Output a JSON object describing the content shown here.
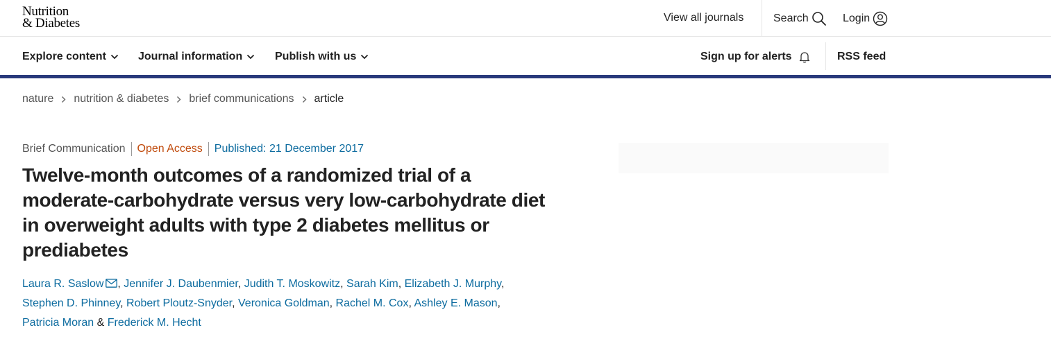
{
  "logo": {
    "line1": "Nutrition",
    "line2": "& Diabetes"
  },
  "topbar": {
    "view_all": "View all journals",
    "search": "Search",
    "login": "Login"
  },
  "nav": {
    "explore": "Explore content",
    "journal_info": "Journal information",
    "publish": "Publish with us",
    "alerts": "Sign up for alerts",
    "rss": "RSS feed"
  },
  "breadcrumb": [
    "nature",
    "nutrition & diabetes",
    "brief communications",
    "article"
  ],
  "article": {
    "type": "Brief Communication",
    "access": "Open Access",
    "published": "Published: 21 December 2017",
    "title": "Twelve-month outcomes of a randomized trial of a moderate-carbohydrate versus very low-carbohydrate diet in overweight adults with type 2 diabetes mellitus or prediabetes",
    "authors": [
      "Laura R. Saslow",
      "Jennifer J. Daubenmier",
      "Judith T. Moskowitz",
      "Sarah Kim",
      "Elizabeth J. Murphy",
      "Stephen D. Phinney",
      "Robert Ploutz-Snyder",
      "Veronica Goldman",
      "Rachel M. Cox",
      "Ashley E. Mason",
      "Patricia Moran",
      "Frederick M. Hecht"
    ],
    "and": "&"
  },
  "colors": {
    "accent_rule": "#29397b",
    "link": "#0c6b9f",
    "open_access": "#c04a0b"
  },
  "icons": {
    "search": "search-icon",
    "login": "user-circle-icon",
    "chevron": "chevron-down-icon",
    "bell": "bell-icon",
    "breadcrumb_sep": "chevron-right-icon",
    "mail": "mail-icon"
  }
}
